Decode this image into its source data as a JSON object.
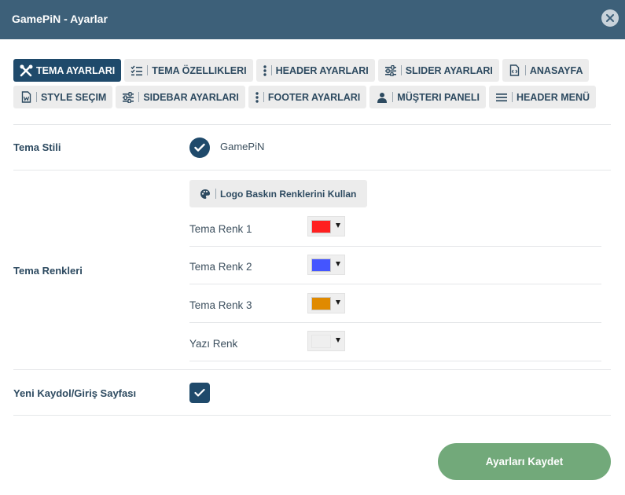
{
  "dialog": {
    "title": "GamePiN - Ayarlar"
  },
  "tabs": {
    "row1": [
      {
        "label": "TEMA AYARLARI",
        "icon": "tools-icon",
        "active": true
      },
      {
        "label": "TEMA ÖZELLIKLERI",
        "icon": "checklist-icon"
      },
      {
        "label": "HEADER AYARLARI",
        "icon": "vertical-dots-icon"
      },
      {
        "label": "SLIDER AYARLARI",
        "icon": "sliders-icon"
      },
      {
        "label": "ANASAYFA",
        "icon": "code-file-icon"
      }
    ],
    "row2": [
      {
        "label": "STYLE SEÇIM",
        "icon": "word-file-icon"
      },
      {
        "label": "SIDEBAR AYARLARI",
        "icon": "sliders-icon"
      },
      {
        "label": "FOOTER AYARLARI",
        "icon": "vertical-dots-icon"
      },
      {
        "label": "MÜŞTERI PANELI",
        "icon": "user-icon"
      },
      {
        "label": "HEADER MENÜ",
        "icon": "menu-icon"
      }
    ]
  },
  "settings": {
    "tema_stili": {
      "label": "Tema Stili",
      "value": "GamePiN"
    },
    "tema_renkleri": {
      "label": "Tema Renkleri",
      "logo_button": "Logo Baskın Renklerini Kullan",
      "colors": [
        {
          "label": "Tema Renk 1",
          "color": "#ff2020"
        },
        {
          "label": "Tema Renk 2",
          "color": "#4455ff"
        },
        {
          "label": "Tema Renk 3",
          "color": "#e08a00"
        },
        {
          "label": "Yazı Renk",
          "color": "#efefef"
        }
      ]
    },
    "kaydol": {
      "label": "Yeni Kaydol/Giriş Sayfası",
      "checked": true
    }
  },
  "save_button": "Ayarları Kaydet"
}
